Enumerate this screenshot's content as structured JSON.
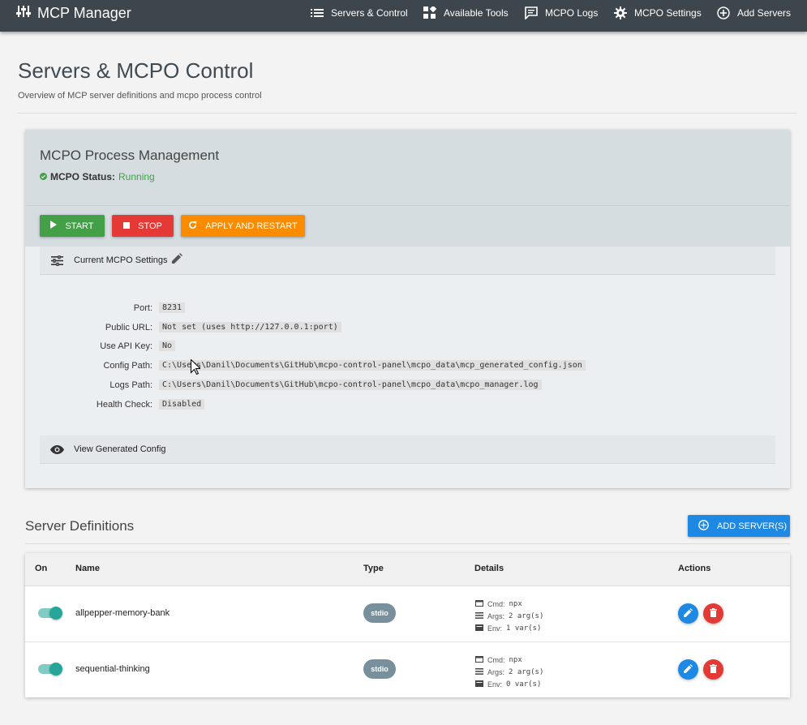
{
  "nav": {
    "brand": "MCP Manager",
    "items": [
      {
        "label": "Servers & Control",
        "icon": "list-icon"
      },
      {
        "label": "Available Tools",
        "icon": "widgets-icon"
      },
      {
        "label": "MCPO Logs",
        "icon": "message-icon"
      },
      {
        "label": "MCPO Settings",
        "icon": "gear-icon"
      },
      {
        "label": "Add Servers",
        "icon": "add-circle-icon"
      }
    ]
  },
  "page": {
    "title": "Servers & MCPO Control",
    "subtitle": "Overview of MCP server definitions and mcpo process control"
  },
  "process": {
    "title": "MCPO Process Management",
    "status_label": "MCPO Status:",
    "status_value": "Running",
    "buttons": {
      "start": "START",
      "stop": "STOP",
      "apply": "APPLY AND RESTART"
    },
    "settings_header": "Current MCPO Settings",
    "settings": [
      {
        "label": "Port:",
        "value": "8231"
      },
      {
        "label": "Public URL:",
        "value": "Not set (uses http://127.0.0.1:port)"
      },
      {
        "label": "Use API Key:",
        "value": "No"
      },
      {
        "label": "Config Path:",
        "value": "C:\\Users\\Danil\\Documents\\GitHub\\mcpo-control-panel\\mcpo_data\\mcp_generated_config.json"
      },
      {
        "label": "Logs Path:",
        "value": "C:\\Users\\Danil\\Documents\\GitHub\\mcpo-control-panel\\mcpo_data\\mcpo_manager.log"
      },
      {
        "label": "Health Check:",
        "value": "Disabled"
      }
    ],
    "generated_config_header": "View Generated Config"
  },
  "servers": {
    "title": "Server Definitions",
    "add_button": "ADD SERVER(S)",
    "columns": [
      "On",
      "Name",
      "Type",
      "Details",
      "Actions"
    ],
    "rows": [
      {
        "enabled": true,
        "name": "allpepper-memory-bank",
        "type": "stdio",
        "cmd_label": "Cmd:",
        "cmd": "npx",
        "args_label": "Args:",
        "args": "2 arg(s)",
        "env_label": "Env:",
        "env": "1 var(s)"
      },
      {
        "enabled": true,
        "name": "sequential-thinking",
        "type": "stdio",
        "cmd_label": "Cmd:",
        "cmd": "npx",
        "args_label": "Args:",
        "args": "2 arg(s)",
        "env_label": "Env:",
        "env": "0 var(s)"
      }
    ]
  },
  "colors": {
    "nav_bg": "#3d464d",
    "start": "#43a047",
    "stop": "#e53935",
    "apply": "#fb8c00",
    "primary": "#1e88e5",
    "toggle_on": "#26a69a",
    "chip": "#78909c",
    "running": "#43a047"
  }
}
